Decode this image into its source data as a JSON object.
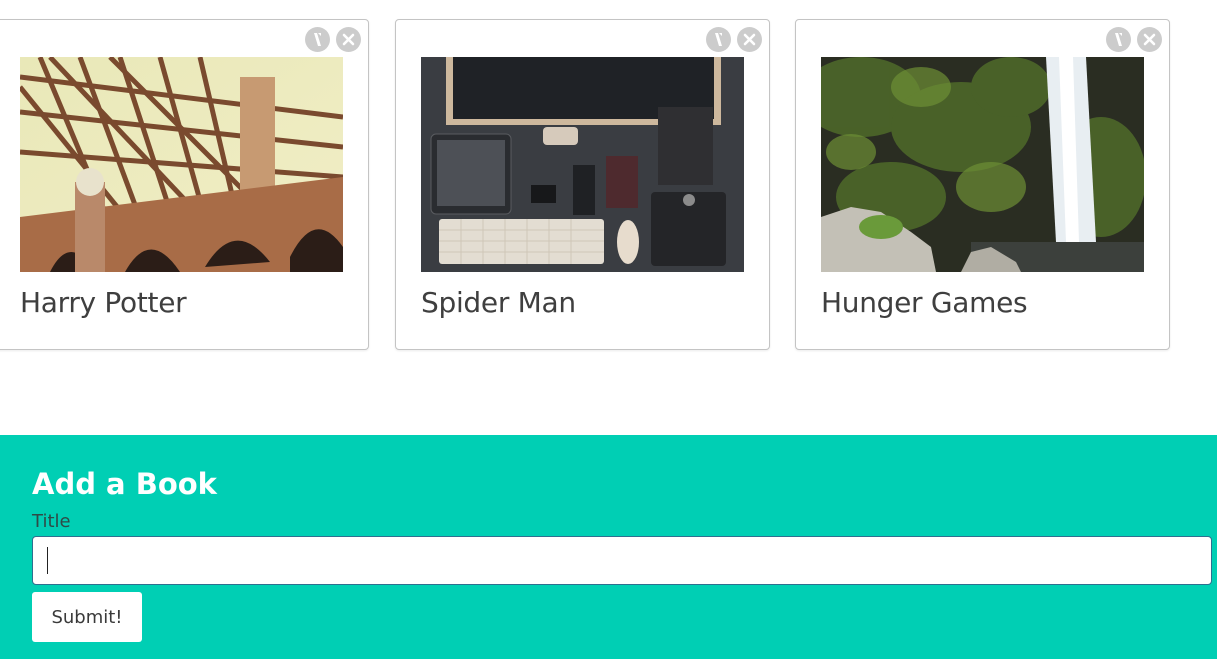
{
  "books": [
    {
      "title": "Harry Potter",
      "image": "bridge-photo"
    },
    {
      "title": "Spider Man",
      "image": "desk-gadgets-photo"
    },
    {
      "title": "Hunger Games",
      "image": "waterfall-photo"
    }
  ],
  "card_actions": {
    "edit_icon": "edit-icon",
    "delete_icon": "close-icon"
  },
  "form": {
    "heading": "Add a Book",
    "title_label": "Title",
    "title_value": "",
    "submit_label": "Submit!"
  },
  "colors": {
    "panel": "#00cfb4",
    "icon_circle": "#cccccc",
    "card_border": "#c4c4c4"
  }
}
